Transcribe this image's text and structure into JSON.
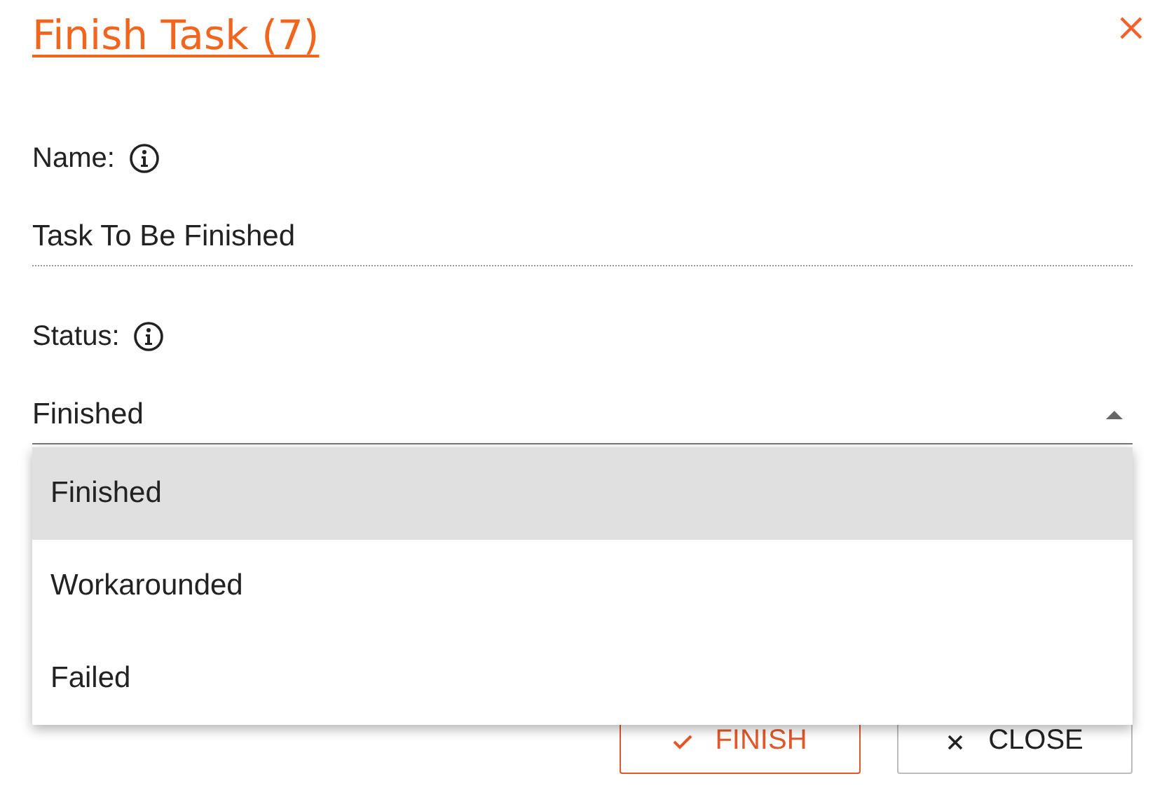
{
  "dialog": {
    "title": "Finish Task (7)"
  },
  "fields": [
    {
      "kind": "text",
      "label": "Name:",
      "value": "Task To Be Finished"
    },
    {
      "kind": "select",
      "label": "Status:",
      "value": "Finished",
      "expanded": true,
      "options": [
        {
          "label": "Finished",
          "selected": true
        },
        {
          "label": "Workarounded",
          "selected": false
        },
        {
          "label": "Failed",
          "selected": false
        }
      ]
    }
  ],
  "buttons": [
    {
      "kind": "primary",
      "label": "FINISH"
    },
    {
      "kind": "secondary",
      "label": "CLOSE"
    }
  ]
}
